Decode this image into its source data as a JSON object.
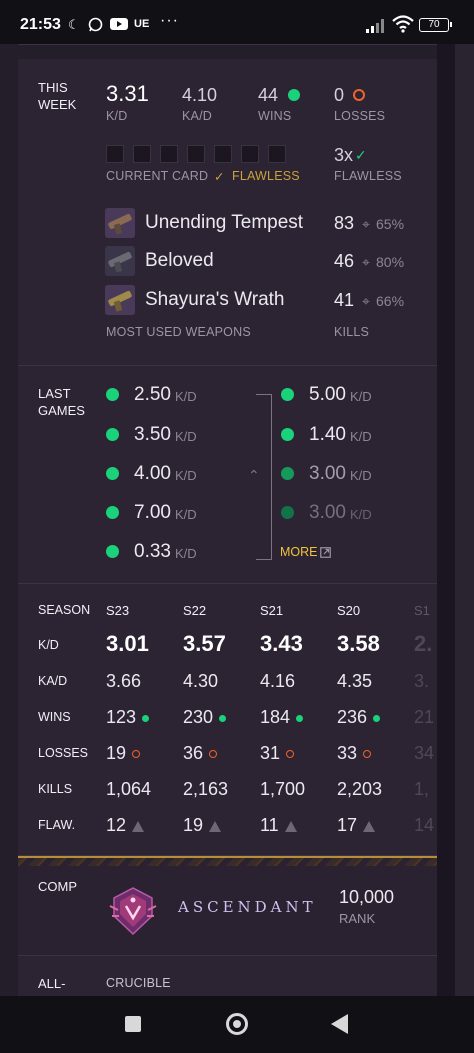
{
  "status_bar": {
    "time": "21:53",
    "carrier_tag": "UE",
    "more": "···",
    "battery": "70"
  },
  "this_week": {
    "section_label": "THIS\nWEEK",
    "kd": {
      "value": "3.31",
      "label": "K/D"
    },
    "kad": {
      "value": "4.10",
      "label": "KA/D"
    },
    "wins": {
      "value": "44",
      "label": "WINS"
    },
    "losses": {
      "value": "0",
      "label": "LOSSES"
    },
    "current_card_label": "CURRENT CARD",
    "flawless_tag": "FLAWLESS",
    "flawless_count": "3x",
    "flawless_label": "FLAWLESS",
    "weapons_label": "MOST USED WEAPONS",
    "kills_label": "KILLS",
    "weapons": [
      {
        "name": "Unending Tempest",
        "kills": "83",
        "precision": "65%"
      },
      {
        "name": "Beloved",
        "kills": "46",
        "precision": "80%"
      },
      {
        "name": "Shayura's Wrath",
        "kills": "41",
        "precision": "66%"
      }
    ]
  },
  "last_games": {
    "section_label": "LAST\nGAMES",
    "unit": "K/D",
    "left": [
      "2.50",
      "3.50",
      "4.00",
      "7.00",
      "0.33"
    ],
    "right": [
      "5.00",
      "1.40",
      "3.00",
      "3.00"
    ],
    "more_label": "MORE"
  },
  "season": {
    "section_label": "SEASON",
    "columns": [
      "S23",
      "S22",
      "S21",
      "S20",
      "S1"
    ],
    "rows": [
      {
        "label": "K/D",
        "values": [
          "3.01",
          "3.57",
          "3.43",
          "3.58",
          "2."
        ]
      },
      {
        "label": "KA/D",
        "values": [
          "3.66",
          "4.30",
          "4.16",
          "4.35",
          "3."
        ]
      },
      {
        "label": "WINS",
        "values": [
          "123",
          "230",
          "184",
          "236",
          "21"
        ]
      },
      {
        "label": "LOSSES",
        "values": [
          "19",
          "36",
          "31",
          "33",
          "34"
        ]
      },
      {
        "label": "KILLS",
        "values": [
          "1,064",
          "2,163",
          "1,700",
          "2,203",
          "1,"
        ]
      },
      {
        "label": "FLAW.",
        "values": [
          "12",
          "19",
          "11",
          "17",
          "14"
        ]
      }
    ]
  },
  "comp": {
    "section_label": "COMP",
    "rank_name": "ASCENDANT",
    "rank_value": "10,000",
    "rank_label": "RANK"
  },
  "all_time": {
    "section_label": "ALL-\nTIME",
    "mode_label": "CRUCIBLE"
  },
  "colors": {
    "win_green": "#19d27a",
    "loss_orange": "#f0632b",
    "flawless_gold": "#c9a23a",
    "more_yellow": "#f0c43a"
  }
}
